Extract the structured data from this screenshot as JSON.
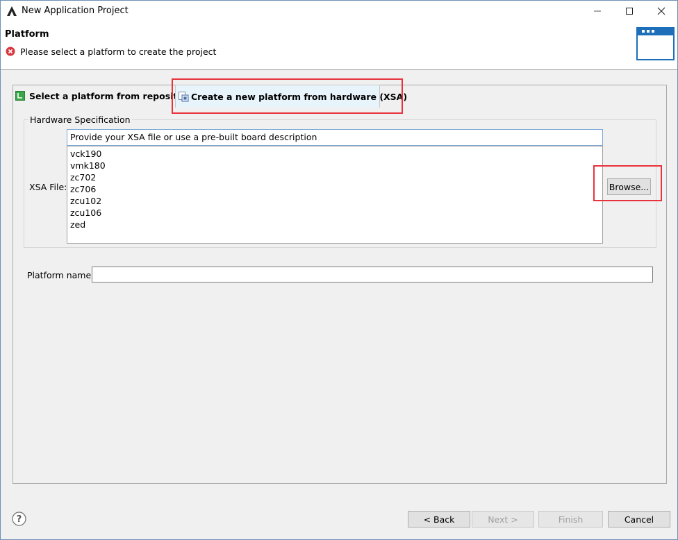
{
  "window": {
    "title": "New Application Project",
    "min_icon": "minimize-icon",
    "max_icon": "maximize-icon",
    "close_icon": "close-icon"
  },
  "header": {
    "title": "Platform",
    "message": "Please select a platform to create the project",
    "message_icon": "error-icon"
  },
  "tabs": [
    {
      "label": "Select a platform from repository",
      "icon": "platform-repo-icon",
      "selected": false
    },
    {
      "label": "Create a new platform from hardware (XSA)",
      "icon": "hardware-icon",
      "selected": true
    }
  ],
  "hardware_spec": {
    "group_title": "Hardware Specification",
    "xsa_label": "XSA File:",
    "xsa_value": "Provide your XSA file or use a pre-built board description",
    "boards": [
      "vck190",
      "vmk180",
      "zc702",
      "zc706",
      "zcu102",
      "zcu106",
      "zed"
    ],
    "browse_label": "Browse..."
  },
  "platform": {
    "name_label": "Platform name:",
    "name_value": ""
  },
  "footer": {
    "help_icon": "help-icon",
    "back_label": "< Back",
    "next_label": "Next >",
    "finish_label": "Finish",
    "cancel_label": "Cancel"
  },
  "colors": {
    "highlight": "#e8323c",
    "selected_tab": "#e8f4fc",
    "error": "#d9363e"
  }
}
